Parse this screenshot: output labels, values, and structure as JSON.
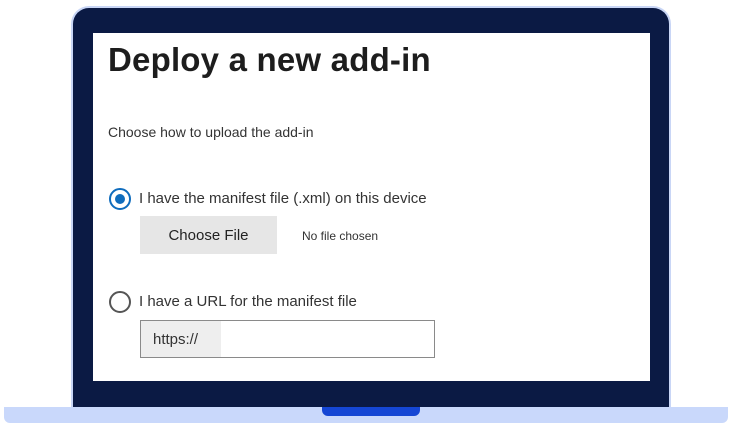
{
  "page": {
    "title": "Deploy a new add-in",
    "subtitle": "Choose how to upload the add-in"
  },
  "options": [
    {
      "label": "I have the manifest file (.xml) on this device",
      "selected": true
    },
    {
      "label": "I have a URL for the manifest file",
      "selected": false
    }
  ],
  "file_picker": {
    "button_label": "Choose File",
    "status": "No file chosen"
  },
  "url_field": {
    "prefix": "https://",
    "value": ""
  },
  "colors": {
    "laptop_frame": "#0b1a44",
    "laptop_base": "#c9d8fb",
    "laptop_notch": "#1546d4",
    "radio_accent": "#0f6cbd"
  },
  "icons": {
    "device": "laptop-icon"
  }
}
